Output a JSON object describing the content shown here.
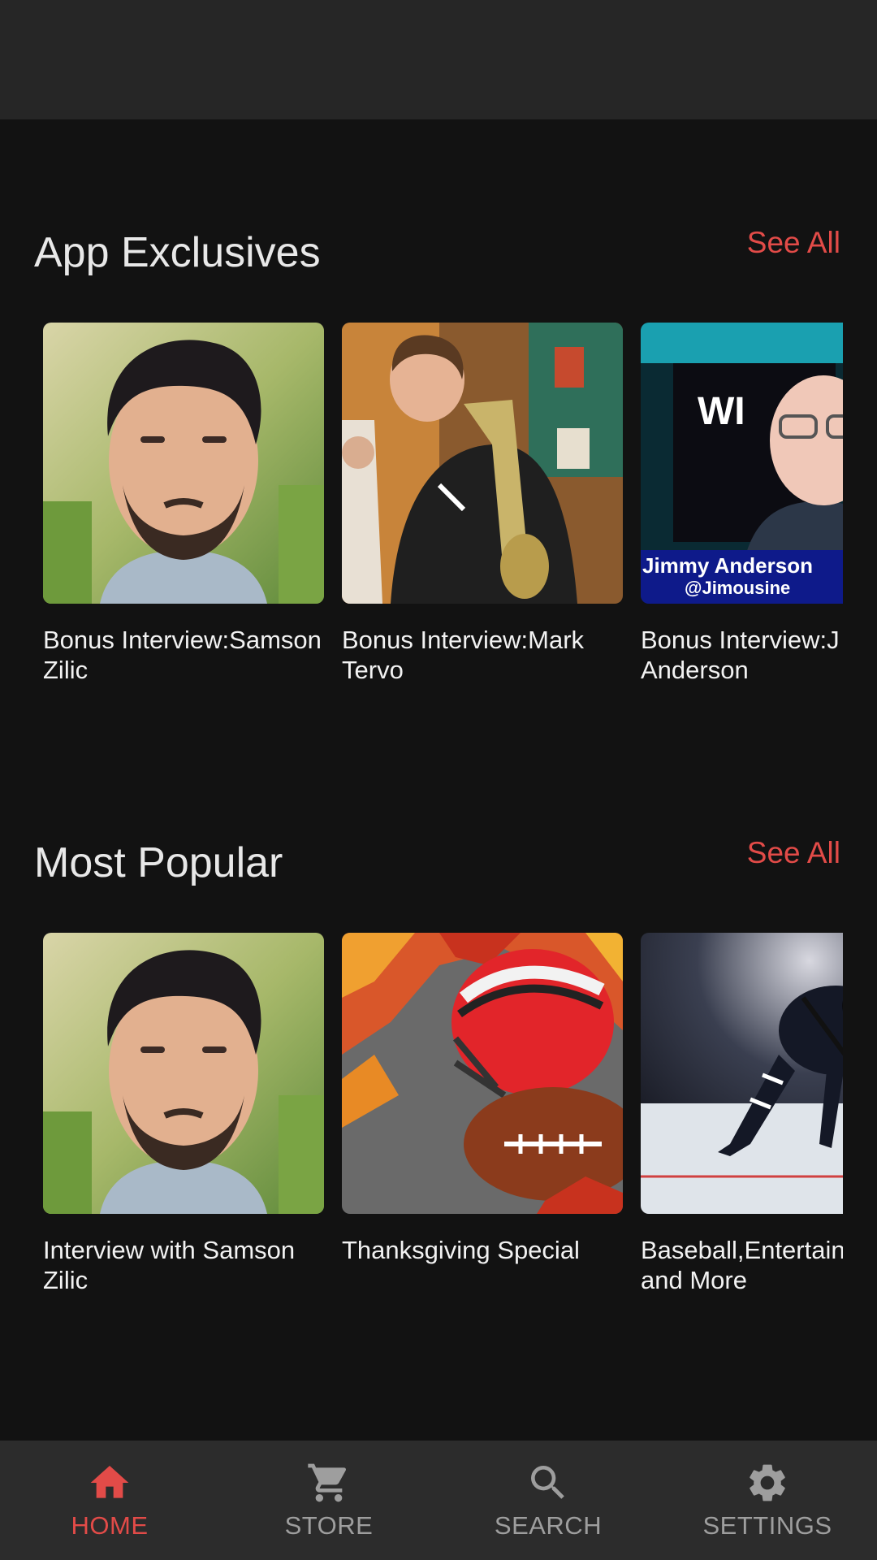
{
  "sections": [
    {
      "title": "App Exclusives",
      "see_all": "See All",
      "cards": [
        {
          "title": "Bonus Interview:Samson Zilic"
        },
        {
          "title": "Bonus Interview:Mark Tervo"
        },
        {
          "line1": "Bonus Interview:J",
          "line2": "Anderson",
          "thumb_text_1": "Jimmy Anderson",
          "thumb_text_2": "@Jimousine"
        }
      ]
    },
    {
      "title": "Most Popular",
      "see_all": "See All",
      "cards": [
        {
          "title": "Interview with Samson Zilic"
        },
        {
          "title": "Thanksgiving Special"
        },
        {
          "line1": "Baseball,Entertainment",
          "line2": "and More"
        }
      ]
    }
  ],
  "nav": {
    "items": [
      {
        "label": "HOME",
        "icon": "home-icon",
        "active": true
      },
      {
        "label": "STORE",
        "icon": "cart-icon",
        "active": false
      },
      {
        "label": "SEARCH",
        "icon": "search-icon",
        "active": false
      },
      {
        "label": "SETTINGS",
        "icon": "gear-icon",
        "active": false
      }
    ]
  },
  "colors": {
    "accent": "#e24b48",
    "background": "#121212",
    "topbar": "#262626",
    "nav": "#2c2c2c"
  }
}
